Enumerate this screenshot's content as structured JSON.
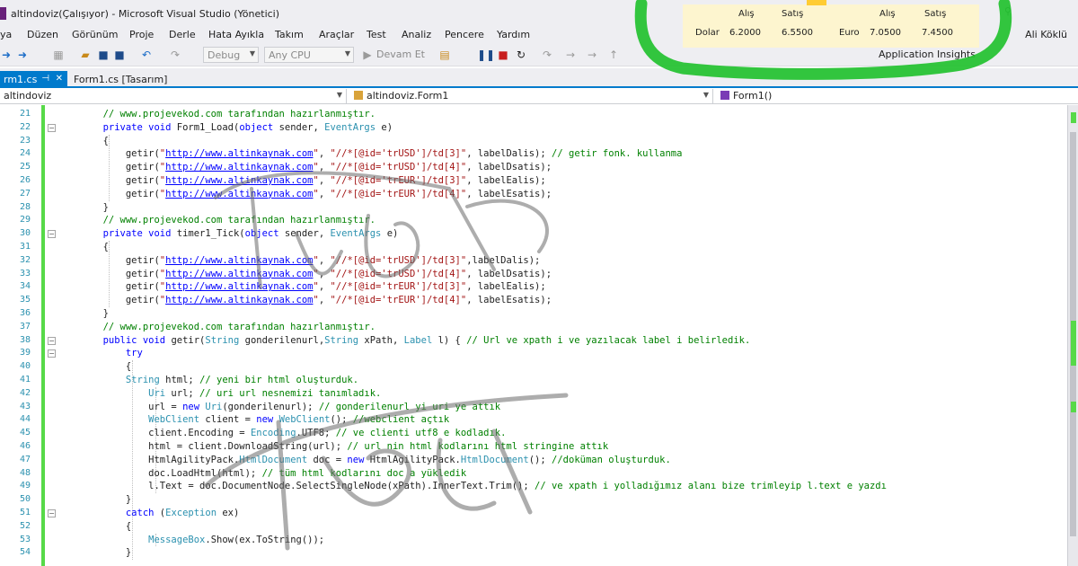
{
  "window": {
    "title": "altindoviz(Çalışıyor) - Microsoft Visual Studio (Yönetici)"
  },
  "menu": {
    "items": [
      "ya",
      "Düzen",
      "Görünüm",
      "Proje",
      "Derle",
      "Hata Ayıkla",
      "Takım",
      "Araçlar",
      "Test",
      "Analiz",
      "Pencere",
      "Yardım"
    ],
    "user": "Ali Köklü"
  },
  "toolbar": {
    "config": "Debug",
    "platform": "Any CPU",
    "continue_label": "Devam Et",
    "app_insights": "Application Insights"
  },
  "tabs": [
    {
      "label": "rm1.cs"
    },
    {
      "label": "Form1.cs [Tasarım]"
    }
  ],
  "navbar": {
    "project": "altindoviz",
    "class": "altindoviz.Form1",
    "member": "Form1()"
  },
  "currency": {
    "buy_header": "Alış",
    "sell_header": "Satış",
    "dollar_label": "Dolar",
    "dollar_buy": "6.2000",
    "dollar_sell": "6.5500",
    "euro_label": "Euro",
    "euro_buy": "7.0500",
    "euro_sell": "7.4500"
  },
  "editor": {
    "line_numbers": [
      "21",
      "22",
      "23",
      "24",
      "25",
      "26",
      "27",
      "28",
      "29",
      "30",
      "31",
      "32",
      "33",
      "34",
      "35",
      "36",
      "37",
      "38",
      "39",
      "40",
      "41",
      "42",
      "43",
      "44",
      "45",
      "46",
      "47",
      "48",
      "49",
      "50",
      "51",
      "52",
      "53",
      "54"
    ],
    "lines": [
      [
        [
          "cm",
          "        // www.projevekod.com tarafından hazırlanmıştır."
        ]
      ],
      [
        [
          "kw",
          "        private void "
        ],
        [
          "",
          "Form1_Load("
        ],
        [
          "kw",
          "object"
        ],
        [
          "",
          " sender, "
        ],
        [
          "ty",
          "EventArgs"
        ],
        [
          "",
          " e)"
        ]
      ],
      [
        [
          "",
          "        {"
        ]
      ],
      [
        [
          "",
          "            getir("
        ],
        [
          "st",
          "\""
        ],
        [
          "url",
          "http://www.altinkaynak.com"
        ],
        [
          "st",
          "\""
        ],
        [
          "",
          ", "
        ],
        [
          "st",
          "\"//*[@id='trUSD']/td[3]\""
        ],
        [
          "",
          ", labelDalis); "
        ],
        [
          "cm",
          "// getir fonk. kullanma"
        ]
      ],
      [
        [
          "",
          "            getir("
        ],
        [
          "st",
          "\""
        ],
        [
          "url",
          "http://www.altinkaynak.com"
        ],
        [
          "st",
          "\""
        ],
        [
          "",
          ", "
        ],
        [
          "st",
          "\"//*[@id='trUSD']/td[4]\""
        ],
        [
          "",
          ", labelDsatis);"
        ]
      ],
      [
        [
          "",
          "            getir("
        ],
        [
          "st",
          "\""
        ],
        [
          "url",
          "http://www.altinkaynak.com"
        ],
        [
          "st",
          "\""
        ],
        [
          "",
          ", "
        ],
        [
          "st",
          "\"//*[@id='trEUR']/td[3]\""
        ],
        [
          "",
          ", labelEalis);"
        ]
      ],
      [
        [
          "",
          "            getir("
        ],
        [
          "st",
          "\""
        ],
        [
          "url",
          "http://www.altinkaynak.com"
        ],
        [
          "st",
          "\""
        ],
        [
          "",
          ", "
        ],
        [
          "st",
          "\"//*[@id='trEUR']/td[4]\""
        ],
        [
          "",
          ", labelEsatis);"
        ]
      ],
      [
        [
          "",
          "        }"
        ]
      ],
      [
        [
          "cm",
          "        // www.projevekod.com tarafından hazırlanmıştır."
        ]
      ],
      [
        [
          "kw",
          "        private void "
        ],
        [
          "",
          "timer1_Tick("
        ],
        [
          "kw",
          "object"
        ],
        [
          "",
          " sender, "
        ],
        [
          "ty",
          "EventArgs"
        ],
        [
          "",
          " e)"
        ]
      ],
      [
        [
          "",
          "        {"
        ]
      ],
      [
        [
          "",
          "            getir("
        ],
        [
          "st",
          "\""
        ],
        [
          "url",
          "http://www.altinkaynak.com"
        ],
        [
          "st",
          "\""
        ],
        [
          "",
          ", "
        ],
        [
          "st",
          "\"//*[@id='trUSD']/td[3]\""
        ],
        [
          "",
          ",labelDalis);"
        ]
      ],
      [
        [
          "",
          "            getir("
        ],
        [
          "st",
          "\""
        ],
        [
          "url",
          "http://www.altinkaynak.com"
        ],
        [
          "st",
          "\""
        ],
        [
          "",
          ", "
        ],
        [
          "st",
          "\"//*[@id='trUSD']/td[4]\""
        ],
        [
          "",
          ", labelDsatis);"
        ]
      ],
      [
        [
          "",
          "            getir("
        ],
        [
          "st",
          "\""
        ],
        [
          "url",
          "http://www.altinkaynak.com"
        ],
        [
          "st",
          "\""
        ],
        [
          "",
          ", "
        ],
        [
          "st",
          "\"//*[@id='trEUR']/td[3]\""
        ],
        [
          "",
          ", labelEalis);"
        ]
      ],
      [
        [
          "",
          "            getir("
        ],
        [
          "st",
          "\""
        ],
        [
          "url",
          "http://www.altinkaynak.com"
        ],
        [
          "st",
          "\""
        ],
        [
          "",
          ", "
        ],
        [
          "st",
          "\"//*[@id='trEUR']/td[4]\""
        ],
        [
          "",
          ", labelEsatis);"
        ]
      ],
      [
        [
          "",
          "        }"
        ]
      ],
      [
        [
          "cm",
          "        // www.projevekod.com tarafından hazırlanmıştır."
        ]
      ],
      [
        [
          "kw",
          "        public void "
        ],
        [
          "",
          "getir("
        ],
        [
          "ty",
          "String"
        ],
        [
          "",
          " gonderilenurl,"
        ],
        [
          "ty",
          "String"
        ],
        [
          "",
          " xPath, "
        ],
        [
          "ty",
          "Label"
        ],
        [
          "",
          " l) { "
        ],
        [
          "cm",
          "// Url ve xpath i ve yazılacak label i belirledik."
        ]
      ],
      [
        [
          "kw",
          "            try"
        ]
      ],
      [
        [
          "",
          "            {"
        ]
      ],
      [
        [
          "ty",
          "            String"
        ],
        [
          "",
          " html; "
        ],
        [
          "cm",
          "// yeni bir html oluşturduk."
        ]
      ],
      [
        [
          "ty",
          "                Uri"
        ],
        [
          "",
          " url; "
        ],
        [
          "cm",
          "// uri url nesnemizi tanımladık."
        ]
      ],
      [
        [
          "",
          "                url = "
        ],
        [
          "kw",
          "new "
        ],
        [
          "ty",
          "Uri"
        ],
        [
          "",
          "(gonderilenurl); "
        ],
        [
          "cm",
          "// gonderilenurl yi uri ye attık"
        ]
      ],
      [
        [
          "ty",
          "                WebClient"
        ],
        [
          "",
          " client = "
        ],
        [
          "kw",
          "new "
        ],
        [
          "ty",
          "WebClient"
        ],
        [
          "",
          "(); "
        ],
        [
          "cm",
          "//webclient açtık"
        ]
      ],
      [
        [
          "",
          "                client.Encoding = "
        ],
        [
          "ty",
          "Encoding"
        ],
        [
          "",
          ".UTF8; "
        ],
        [
          "cm",
          "// ve clienti utf8 e kodladık."
        ]
      ],
      [
        [
          "",
          "                html = client.DownloadString(url); "
        ],
        [
          "cm",
          "// url nin html kodlarını html stringine attık"
        ]
      ],
      [
        [
          "",
          "                HtmlAgilityPack."
        ],
        [
          "ty",
          "HtmlDocument"
        ],
        [
          "",
          " doc = "
        ],
        [
          "kw",
          "new "
        ],
        [
          "",
          "HtmlAgilityPack."
        ],
        [
          "ty",
          "HtmlDocument"
        ],
        [
          "",
          "(); "
        ],
        [
          "cm",
          "//doküman oluşturduk."
        ]
      ],
      [
        [
          "",
          "                doc.LoadHtml(html); "
        ],
        [
          "cm",
          "// tüm html kodlarını doc a yükledik"
        ]
      ],
      [
        [
          "",
          "                l.Text = doc.DocumentNode.SelectSingleNode(xPath).InnerText.Trim(); "
        ],
        [
          "cm",
          "// ve xpath i yolladığımız alanı bize trimleyip l.text e yazdı"
        ]
      ],
      [
        [
          "",
          "            }"
        ]
      ],
      [
        [
          "kw",
          "            catch "
        ],
        [
          "",
          "("
        ],
        [
          "ty",
          "Exception"
        ],
        [
          "",
          " ex)"
        ]
      ],
      [
        [
          "",
          "            {"
        ]
      ],
      [
        [
          "ty",
          "                MessageBox"
        ],
        [
          "",
          ".Show(ex.ToString());"
        ]
      ],
      [
        [
          "",
          "            }"
        ]
      ]
    ]
  }
}
